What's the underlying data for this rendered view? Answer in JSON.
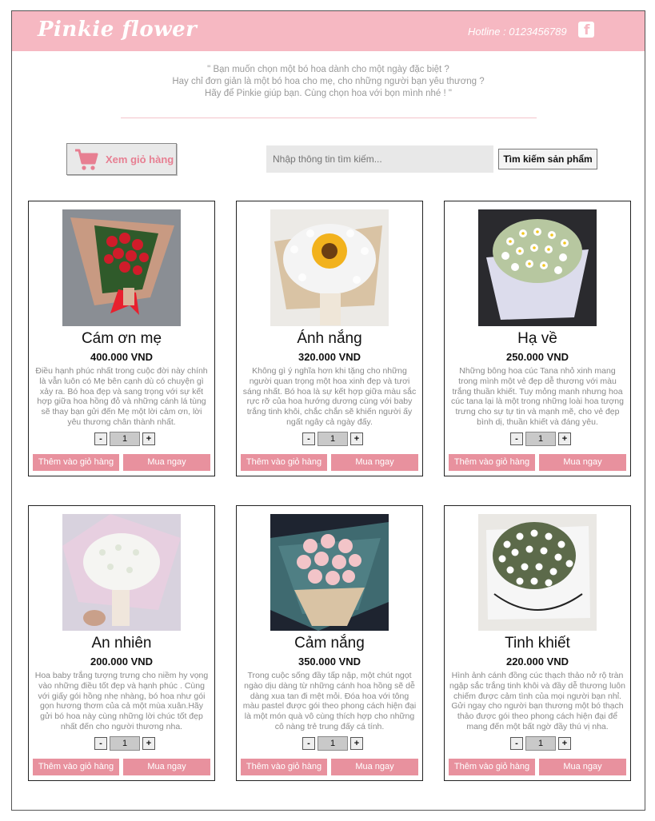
{
  "header": {
    "logo": "Pinkie flower",
    "hotline": "Hotline : 0123456789",
    "facebook_icon": "facebook-icon",
    "background": "#f6b8c2"
  },
  "intro": {
    "line1": "\" Bạn muốn chọn một bó hoa dành cho một ngày đặc biệt ?",
    "line2": "Hay chỉ đơn giản là một bó hoa cho mẹ, cho những người bạn yêu thương ?",
    "line3": "Hãy để Pinkie giúp bạn. Cùng chọn hoa với bọn mình nhé ! \""
  },
  "toolbar": {
    "cart_label": "Xem giỏ hàng",
    "cart_icon": "shopping-cart-icon",
    "search_placeholder": "Nhập thông tin tìm kiếm...",
    "search_button": "Tìm kiếm sản phẩm"
  },
  "products": [
    {
      "name": "Cám ơn mẹ",
      "price": "400.000 VND",
      "desc": "Điều hạnh phúc nhất trong cuộc đời này chính là vẫn luôn có Mẹ bên cạnh dù có chuyện gì xảy ra. Bó hoa đẹp và sang trọng với sự kết hợp giữa hoa hồng đỏ và những cánh lá tùng sẽ thay bạn gửi đến Mẹ một lời cảm ơn, lời yêu thương chân thành nhất.",
      "qty": "1",
      "image": "red-rose-bouquet"
    },
    {
      "name": "Ánh nắng",
      "price": "320.000 VND",
      "desc": "Không gì ý nghĩa hơn khi tặng cho những người quan trọng một hoa xinh đẹp và tươi sáng nhất. Bó hoa là sự kết hợp giữa màu sắc rực rỡ của hoa hướng dương cùng với baby trắng tinh khôi, chắc chắn sẽ khiến người ấy ngất ngây cả ngày đấy.",
      "qty": "1",
      "image": "sunflower-bouquet"
    },
    {
      "name": "Hạ về",
      "price": "250.000 VND",
      "desc": "Những bông hoa cúc Tana nhỏ xinh mang trong mình một vẻ đẹp dễ thương với màu trắng thuần khiết. Tuy mỏng manh nhưng hoa cúc tana lại là một trong những loài hoa tượng trưng cho sự tự tin và mạnh mẽ, cho vẻ đẹp bình dị, thuần khiết và đáng yêu.",
      "qty": "1",
      "image": "daisy-bouquet"
    },
    {
      "name": "An nhiên",
      "price": "200.000 VND",
      "desc": "Hoa baby trắng tượng trưng cho niềm hy vọng vào những điều tốt đẹp và hạnh phúc . Cùng với giấy gói hồng nhẹ nhàng, bó hoa như gói gọn hương thơm của cả một mùa xuân.Hãy gửi bó hoa này cùng những lời chúc tốt đẹp nhất đến cho người thương nha.",
      "qty": "1",
      "image": "babys-breath-bouquet"
    },
    {
      "name": "Cảm nắng",
      "price": "350.000 VND",
      "desc": "Trong cuộc sống đầy tấp nập, một chút ngọt ngào dịu dàng từ những cánh hoa hồng sẽ dễ dàng xua tan đi mệt mỏi. Đóa hoa với tông màu pastel được gói theo phong cách hiện đại là một món quà vô cùng thích hợp cho những cô nàng trẻ trung đấy cá tính.",
      "qty": "1",
      "image": "pink-rose-bouquet"
    },
    {
      "name": "Tinh khiết",
      "price": "220.000 VND",
      "desc": "Hình ảnh cánh đồng cúc thạch thảo nở rộ tràn ngập sắc trắng tinh khôi và đầy dễ thương luôn chiếm được cảm tình của mọi người bạn nhỉ. Gửi ngay cho người bạn thương một bó thạch thảo được gói theo phong cách hiện đại để mang đến một bất ngờ đầy thú vị nha.",
      "qty": "1",
      "image": "white-aster-bouquet"
    }
  ],
  "card_buttons": {
    "minus": "-",
    "plus": "+",
    "add_to_cart": "Thêm vào giỏ hàng",
    "buy_now": "Mua ngay"
  },
  "colors": {
    "accent": "#e8919e",
    "cart_text": "#e77f92"
  }
}
